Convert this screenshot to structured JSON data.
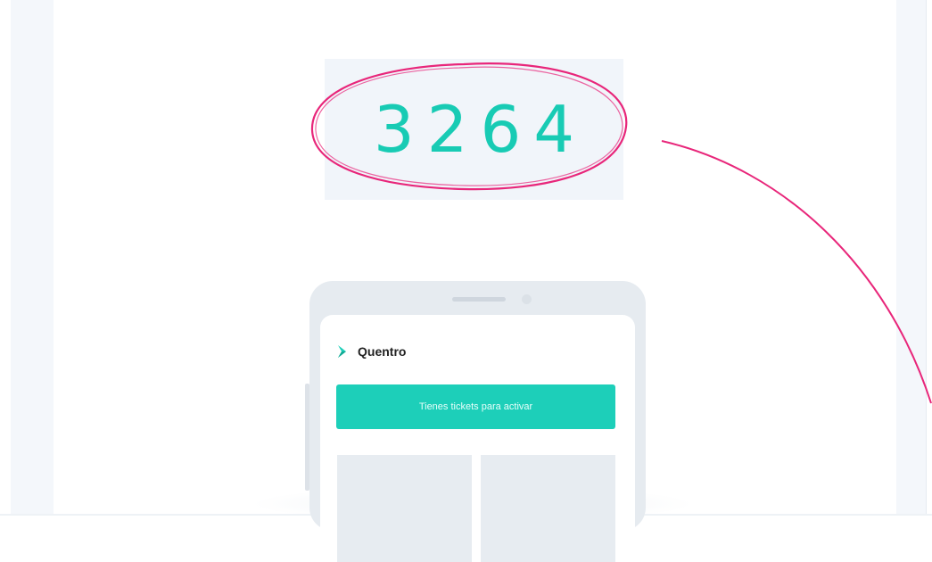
{
  "verification": {
    "code_digits": "3264"
  },
  "phone": {
    "brand_name": "Quentro",
    "cta_label": "Tienes tickets para activar"
  },
  "colors": {
    "accent_teal": "#18cbb4",
    "annotation_pink": "#e8267a",
    "code_box_bg": "#f1f5fa"
  },
  "icons": [
    "quentro-logo-icon"
  ]
}
